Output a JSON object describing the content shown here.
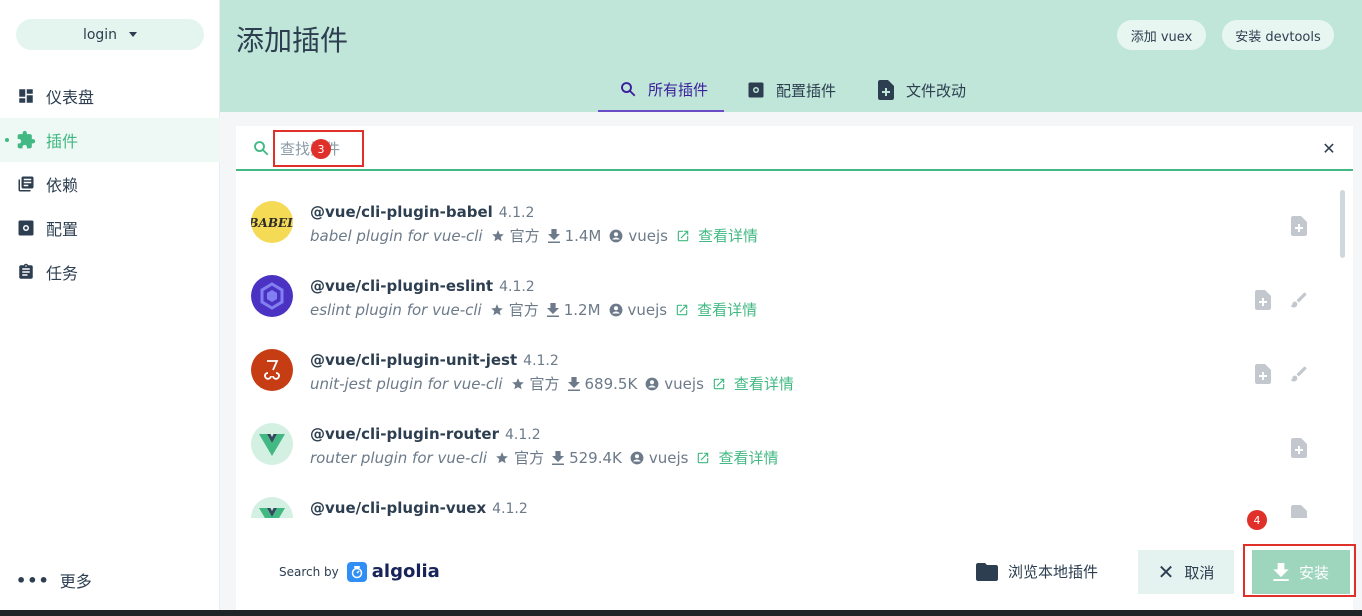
{
  "sidebar": {
    "project": "login",
    "items": [
      {
        "label": "仪表盘",
        "icon": "dashboard-icon"
      },
      {
        "label": "插件",
        "icon": "puzzle-icon"
      },
      {
        "label": "依赖",
        "icon": "library-icon"
      },
      {
        "label": "配置",
        "icon": "settings-icon"
      },
      {
        "label": "任务",
        "icon": "clipboard-icon"
      }
    ],
    "more": "更多"
  },
  "header": {
    "title": "添加插件",
    "btn_vuex": "添加 vuex",
    "btn_devtools": "安装 devtools"
  },
  "tabs": [
    {
      "label": "所有插件",
      "icon": "search-icon"
    },
    {
      "label": "配置插件",
      "icon": "settings-icon"
    },
    {
      "label": "文件改动",
      "icon": "file-diff-icon"
    }
  ],
  "search": {
    "placeholder": "查找插件",
    "value": ""
  },
  "annotations": {
    "badge3": "3",
    "badge4": "4"
  },
  "plugins": [
    {
      "name": "@vue/cli-plugin-babel",
      "version": "4.1.2",
      "desc": "babel plugin for vue-cli",
      "official": "官方",
      "downloads": "1.4M",
      "author": "vuejs",
      "details": "查看详情",
      "logo": "babel-logo"
    },
    {
      "name": "@vue/cli-plugin-eslint",
      "version": "4.1.2",
      "desc": "eslint plugin for vue-cli",
      "official": "官方",
      "downloads": "1.2M",
      "author": "vuejs",
      "details": "查看详情",
      "logo": "eslint-logo"
    },
    {
      "name": "@vue/cli-plugin-unit-jest",
      "version": "4.1.2",
      "desc": "unit-jest plugin for vue-cli",
      "official": "官方",
      "downloads": "689.5K",
      "author": "vuejs",
      "details": "查看详情",
      "logo": "jest-logo"
    },
    {
      "name": "@vue/cli-plugin-router",
      "version": "4.1.2",
      "desc": "router plugin for vue-cli",
      "official": "官方",
      "downloads": "529.4K",
      "author": "vuejs",
      "details": "查看详情",
      "logo": "vue-logo"
    },
    {
      "name": "@vue/cli-plugin-vuex",
      "version": "4.1.2",
      "logo": "vue-logo"
    }
  ],
  "footer": {
    "search_by": "Search by",
    "algolia": "algolia",
    "browse_local": "浏览本地插件",
    "cancel": "取消",
    "install": "安装"
  },
  "colors": {
    "accent": "#42b983",
    "header_bg": "#bfe6d8",
    "active_tab": "#3b1e9c",
    "annotation_red": "#e0302a"
  }
}
